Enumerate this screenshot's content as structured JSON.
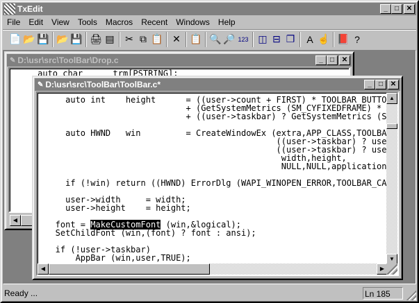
{
  "app": {
    "title": "TxEdit"
  },
  "menu": [
    "File",
    "Edit",
    "View",
    "Tools",
    "Macros",
    "Recent",
    "Windows",
    "Help"
  ],
  "toolbar": [
    {
      "name": "new-file-icon",
      "glyph": "📄"
    },
    {
      "name": "open-icon",
      "glyph": "📂"
    },
    {
      "name": "save-icon",
      "glyph": "💾"
    },
    "sep",
    {
      "name": "open-project-icon",
      "glyph": "📂"
    },
    {
      "name": "save-all-icon",
      "glyph": "💾"
    },
    "sep",
    {
      "name": "print-icon",
      "glyph": "🖨"
    },
    {
      "name": "print-setup-icon",
      "glyph": "▤"
    },
    "sep",
    {
      "name": "cut-icon",
      "glyph": "✂"
    },
    {
      "name": "copy-icon",
      "glyph": "⧉"
    },
    {
      "name": "paste-icon",
      "glyph": "📋"
    },
    "sep",
    {
      "name": "delete-icon",
      "glyph": "✕"
    },
    "sep",
    {
      "name": "clipboard-icon",
      "glyph": "📋"
    },
    "sep",
    {
      "name": "find-icon",
      "glyph": "🔍"
    },
    {
      "name": "replace-icon",
      "glyph": "🔎"
    },
    {
      "name": "goto-line-icon",
      "glyph": "123"
    },
    "sep",
    {
      "name": "tile-vertical-icon",
      "glyph": "◫"
    },
    {
      "name": "tile-horizontal-icon",
      "glyph": "⊟"
    },
    {
      "name": "cascade-icon",
      "glyph": "❐"
    },
    "sep",
    {
      "name": "font-icon",
      "glyph": "A"
    },
    {
      "name": "pointer-hand-icon",
      "glyph": "☝"
    },
    "sep",
    {
      "name": "book-icon",
      "glyph": "📕"
    },
    {
      "name": "help-icon",
      "glyph": "?"
    }
  ],
  "windows": {
    "drop": {
      "title": "D:\\usr\\src\\ToolBar\\Drop.c",
      "line": "     auto char      trm[PSTRING];"
    },
    "toolbar": {
      "title": "D:\\usr\\src\\ToolBar\\ToolBar.c*",
      "lines_before": "     auto int    height      = ((user->count + FIRST) * TOOLBAR_BUTTON\n                             + (GetSystemMetrics (SM_CYFIXEDFRAME) * D\n                             + ((user->taskbar) ? GetSystemMetrics (SM\n\n     auto HWND   win         = CreateWindowEx (extra,APP_CLASS,TOOLBAR\n                                               ((user->taskbar) ? user-\n                                               ((user->taskbar) ? user-\n                                                width,height,\n                                                NULL,NULL,application,N\n\n     if (!win) return ((HWND) ErrorDlg (WAPI_WINOPEN_ERROR,TOOLBAR_CAP\n\n     user->width     = width;\n     user->height    = height;\n\n   font = ",
      "selected": "MakeCustomFont",
      "lines_after": " (win,&logical);\n   SetChildFont (win,(font) ? font : ansi);\n\n   if (!user->taskbar)\n       AppBar (win,user,TRUE);"
    }
  },
  "status": {
    "text": "Ready ...",
    "line": "Ln 185"
  }
}
